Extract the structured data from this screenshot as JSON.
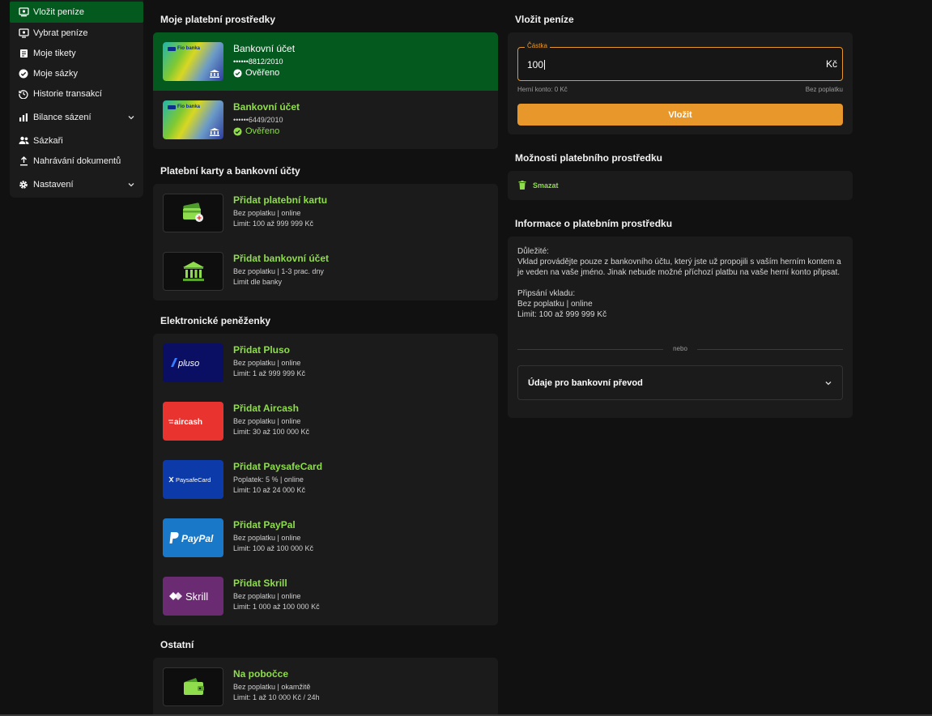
{
  "sidebar": {
    "items": [
      {
        "label": "Vložit peníze",
        "icon": "deposit-icon",
        "active": true
      },
      {
        "label": "Vybrat peníze",
        "icon": "withdraw-icon"
      },
      {
        "label": "Moje tikety",
        "icon": "tickets-icon"
      },
      {
        "label": "Moje sázky",
        "icon": "check-circle-icon"
      },
      {
        "label": "Historie transakcí",
        "icon": "history-icon"
      },
      {
        "label": "Bilance sázení",
        "icon": "balance-icon",
        "expandable": true
      },
      {
        "label": "Sázkaři",
        "icon": "users-icon"
      },
      {
        "label": "Nahrávání dokumentů",
        "icon": "upload-icon"
      },
      {
        "label": "Nastavení",
        "icon": "gear-icon",
        "expandable": true
      }
    ]
  },
  "my_methods": {
    "title": "Moje platební prostředky",
    "items": [
      {
        "name": "Bankovní účet",
        "account": "••••••8812/2010",
        "status": "Ověřeno",
        "selected": true
      },
      {
        "name": "Bankovní účet",
        "account": "••••••6449/2010",
        "status": "Ověřeno",
        "selected": false
      }
    ],
    "card_brand": "Fio banka"
  },
  "cards_accounts": {
    "title": "Platební karty a bankovní účty",
    "items": [
      {
        "name": "Přidat platební kartu",
        "line1": "Bez poplatku  |  online",
        "line2": "Limit: 100 až 999 999 Kč"
      },
      {
        "name": "Přidat bankovní účet",
        "line1": "Bez poplatku  |  1-3 prac. dny",
        "line2": "Limit dle banky"
      }
    ]
  },
  "ewallets": {
    "title": "Elektronické peněženky",
    "items": [
      {
        "name": "Přidat Pluso",
        "line1": "Bez poplatku  |  online",
        "line2": "Limit: 1 až 999 999 Kč",
        "logo": "pluso",
        "color": "#0a0f63"
      },
      {
        "name": "Přidat Aircash",
        "line1": "Bez poplatku  |  online",
        "line2": "Limit: 30 až 100 000 Kč",
        "logo": "aircash",
        "color": "#e8332f"
      },
      {
        "name": "Přidat PaysafeCard",
        "line1": "Poplatek: 5 %  |  online",
        "line2": "Limit: 10 až 24 000 Kč",
        "logo": "PaysafeCard",
        "color": "#0d3aa9"
      },
      {
        "name": "Přidat PayPal",
        "line1": "Bez poplatku  |  online",
        "line2": "Limit: 100 až 100 000 Kč",
        "logo": "PayPal",
        "color": "#1a78c8"
      },
      {
        "name": "Přidat Skrill",
        "line1": "Bez poplatku  |  online",
        "line2": "Limit: 1 000 až 100 000 Kč",
        "logo": "Skrill",
        "color": "#6b2b73"
      }
    ]
  },
  "other": {
    "title": "Ostatní",
    "items": [
      {
        "name": "Na pobočce",
        "line1": "Bez poplatku  |  okamžitě",
        "line2": "Limit: 1 až 10 000 Kč / 24h"
      }
    ]
  },
  "deposit": {
    "title": "Vložit peníze",
    "amount_label": "Částka",
    "amount_value": "100",
    "currency": "Kč",
    "game_account": "Herní konto: 0 Kč",
    "fee": "Bez poplatku",
    "button": "Vložit"
  },
  "options": {
    "title": "Možnosti platebního prostředku",
    "delete": "Smazat"
  },
  "method_info": {
    "title": "Informace o platebním prostředku",
    "important_label": "Důležité:",
    "important_text": "Vklad provádějte pouze z bankovního účtu, který jste už propojili s vaším herním kontem a je veden na vaše jméno. Jinak nebude možné příchozí platbu na vaše herní konto připsat.",
    "credit_label": "Připsání vkladu:",
    "credit_line1": "Bez poplatku  |  online",
    "credit_line2": "Limit: 100 až 999 999 Kč",
    "or": "nebo",
    "transfer": "Údaje pro bankovní převod"
  },
  "colors": {
    "accent_green": "#8fdc4c",
    "selected_green": "#04591f",
    "orange": "#e8982a",
    "panel": "#1b1b1b",
    "background": "#111111"
  }
}
